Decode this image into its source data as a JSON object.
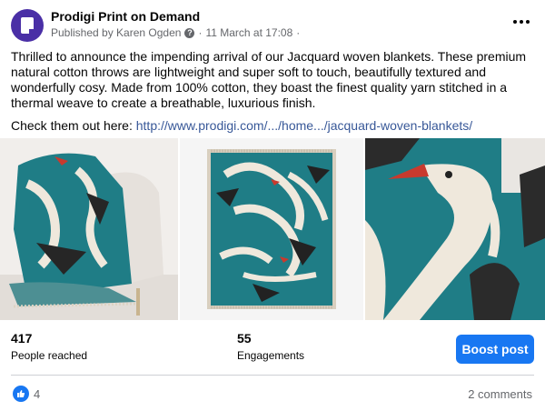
{
  "post": {
    "page_name": "Prodigi Print on Demand",
    "published_by": "Published by Karen Ogden",
    "date_prefix": "·",
    "date": "11 March at 17:08",
    "date_suffix": "·",
    "paragraph1": "Thrilled to announce the impending arrival of our Jacquard woven blankets. These premium natural cotton throws are lightweight and super soft to touch, beautifully textured and wonderfully cosy. Made from 100% cotton, they boast the finest quality yarn stitched in a thermal weave to create a breathable, luxurious finish.",
    "paragraph2_prefix": "Check them out here: ",
    "link_text": "http://www.prodigi.com/.../home.../jacquard-woven-blankets/"
  },
  "images": [
    {
      "name": "blanket-on-chair"
    },
    {
      "name": "blanket-flat"
    },
    {
      "name": "blanket-close-up"
    }
  ],
  "stats": {
    "reached_value": "417",
    "reached_label": "People reached",
    "engagements_value": "55",
    "engagements_label": "Engagements",
    "boost_label": "Boost post"
  },
  "footer": {
    "likes": "4",
    "comments": "2 comments"
  },
  "colors": {
    "accent": "#1877f2",
    "teal": "#1f7d86",
    "link": "#385898"
  },
  "icons": [
    "page-avatar-icon",
    "help-icon",
    "more-icon",
    "like-icon"
  ]
}
